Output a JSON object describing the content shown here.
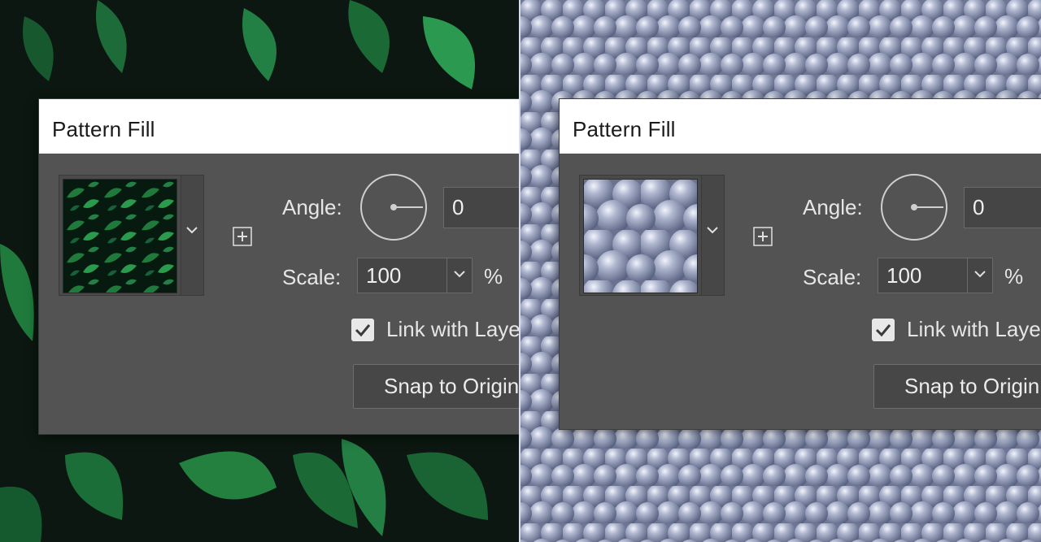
{
  "panels": {
    "left": {
      "background": "leaves-photo",
      "dialog": {
        "title": "Pattern Fill",
        "pattern_preview": "leaves-pattern",
        "angle_label": "Angle:",
        "angle_value": "0",
        "scale_label": "Scale:",
        "scale_value": "100",
        "percent_unit": "%",
        "link_with_layer_label": "Link with Layer",
        "link_with_layer_checked": true,
        "snap_button_label": "Snap to Origin"
      }
    },
    "right": {
      "background": "metallic-bubbles-pattern",
      "dialog": {
        "title": "Pattern Fill",
        "pattern_preview": "bubbles-pattern",
        "angle_label": "Angle:",
        "angle_value": "0",
        "scale_label": "Scale:",
        "scale_value": "100",
        "percent_unit": "%",
        "link_with_layer_label": "Link with Layer",
        "link_with_layer_checked": true,
        "snap_button_label": "Snap to Origin"
      }
    }
  },
  "colors": {
    "dialog_bg": "#535353",
    "titlebar_bg": "#ffffff",
    "field_bg": "#454545",
    "text": "#e6e6e6",
    "leaf_green": "#1f7a3c",
    "bubble_blue": "#9aa3bd"
  }
}
